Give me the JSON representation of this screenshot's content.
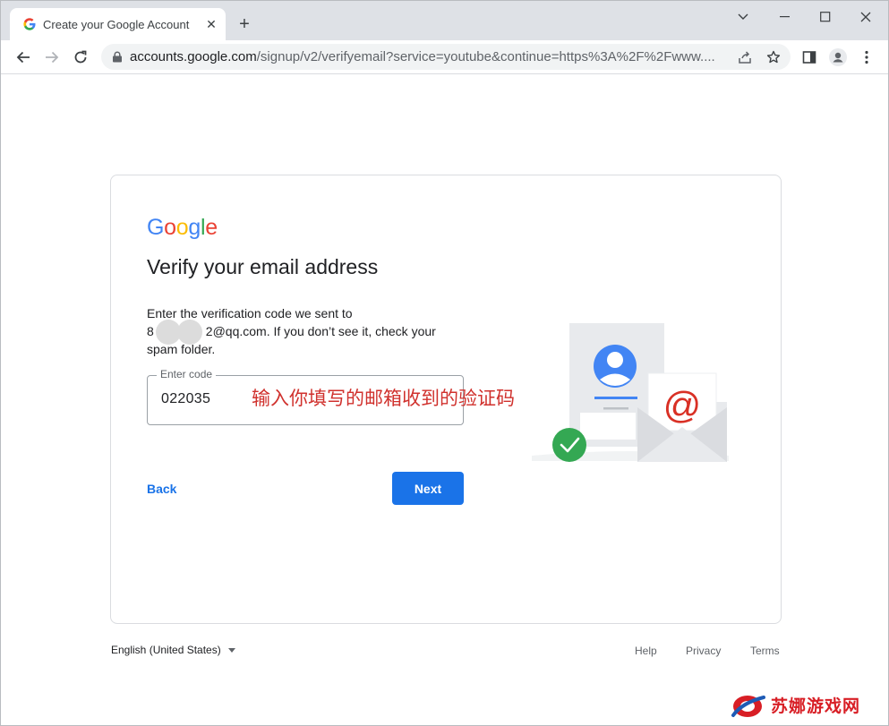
{
  "browser": {
    "tab_title": "Create your Google Account",
    "url_host": "accounts.google.com",
    "url_path": "/signup/v2/verifyemail?service=youtube&continue=https%3A%2F%2Fwww...."
  },
  "card": {
    "logo_letters": [
      "G",
      "o",
      "o",
      "g",
      "l",
      "e"
    ],
    "logo_colors": [
      "#4285f4",
      "#ea4335",
      "#fbbc05",
      "#4285f4",
      "#34a853",
      "#ea4335"
    ],
    "heading": "Verify your email address",
    "desc_line1": "Enter the verification code we sent to",
    "email_prefix": "8",
    "email_suffix": "2@qq.com. If you don’t see it, check your",
    "desc_line3": "spam folder.",
    "field_label": "Enter code",
    "field_value": "022035",
    "annotation": "输入你填写的邮箱收到的验证码",
    "back_label": "Back",
    "next_label": "Next"
  },
  "footer": {
    "language": "English (United States)",
    "help": "Help",
    "privacy": "Privacy",
    "terms": "Terms"
  },
  "watermark": {
    "text": "苏娜游戏网"
  },
  "colors": {
    "accent": "#1a73e8",
    "annotation": "#d0312d",
    "watermark": "#d81e25"
  }
}
